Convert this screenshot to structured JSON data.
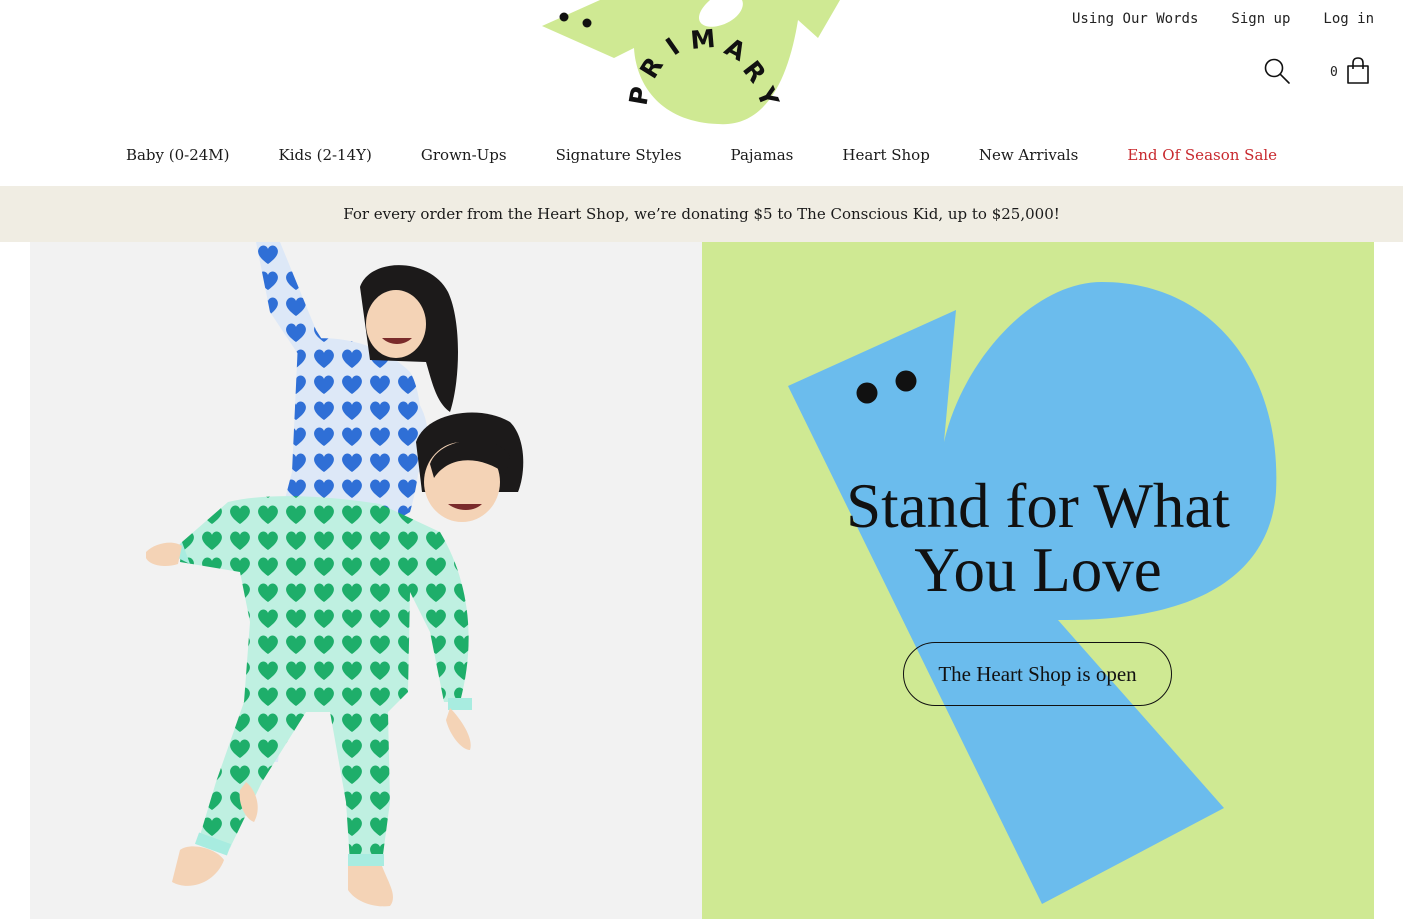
{
  "brand": {
    "name": "PRIMARY",
    "letters": [
      "P",
      "R",
      "I",
      "M",
      "A",
      "R",
      "Y"
    ],
    "green": "#cfe993",
    "blue": "#6bbced",
    "sale_red": "#c8292e",
    "banner_bg": "#f0ede3"
  },
  "util_nav": {
    "links": [
      "Using Our Words",
      "Sign up",
      "Log in"
    ]
  },
  "header": {
    "search_icon": "search-icon",
    "cart_icon": "shopping-bag-icon",
    "cart_count": "0"
  },
  "main_nav": {
    "items": [
      "Baby (0-24M)",
      "Kids (2-14Y)",
      "Grown-Ups",
      "Signature Styles",
      "Pajamas",
      "Heart Shop",
      "New Arrivals",
      "End Of Season Sale"
    ]
  },
  "announcement": {
    "text": "For every order from the Heart Shop, we’re donating $5 to The Conscious Kid, up to $25,000!"
  },
  "hero": {
    "title_line1": "Stand for What",
    "title_line2": "You Love",
    "cta": "The Heart Shop is open"
  }
}
